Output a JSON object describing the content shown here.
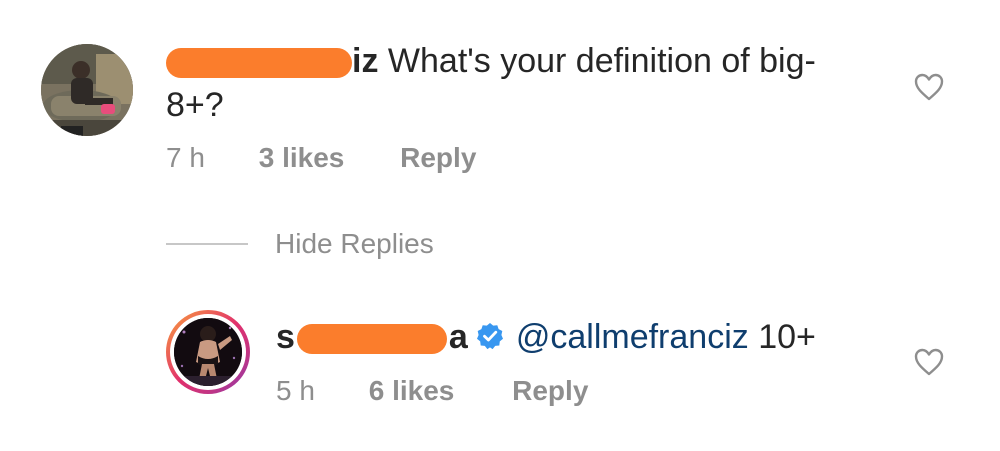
{
  "comment": {
    "username_visible_end": "iz",
    "text_line1": "What's your definition of big-",
    "text_line2": "8+?",
    "time": "7 h",
    "likes": "3 likes",
    "reply_label": "Reply"
  },
  "hide_replies_label": "Hide Replies",
  "reply": {
    "username_visible_start": "s",
    "username_visible_end": "a",
    "mention": "@callmefranciz",
    "text": "10+",
    "time": "5 h",
    "likes": "6 likes",
    "reply_label": "Reply"
  },
  "icons": {
    "like": "heart-outline-icon",
    "verified": "verified-badge-icon"
  },
  "colors": {
    "redaction": "#fb7d2c",
    "mention": "#0f3e6e",
    "verified": "#3897f0",
    "meta_text": "#8e8e8e"
  }
}
